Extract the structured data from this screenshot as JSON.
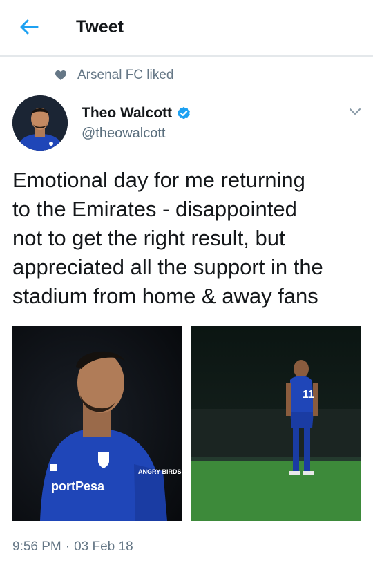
{
  "header": {
    "title": "Tweet"
  },
  "social_context": {
    "text": "Arsenal FC liked"
  },
  "author": {
    "name": "Theo Walcott",
    "handle": "@theowalcott"
  },
  "tweet": {
    "text": "Emotional day for me returning\nto the Emirates - disappointed\nnot to get the right result, but\nappreciated all the support in the\nstadium from home & away fans",
    "time": "9:56 PM",
    "separator": "·",
    "date": "03 Feb 18"
  },
  "media": [
    {
      "shirt_text": "portPesa",
      "badge_text": "ANGRY BIRDS"
    },
    {
      "shirt_number": "11"
    }
  ],
  "colors": {
    "accent": "#1da1f2",
    "text": "#14171a",
    "muted": "#657786",
    "everton_blue": "#1f46b8"
  }
}
